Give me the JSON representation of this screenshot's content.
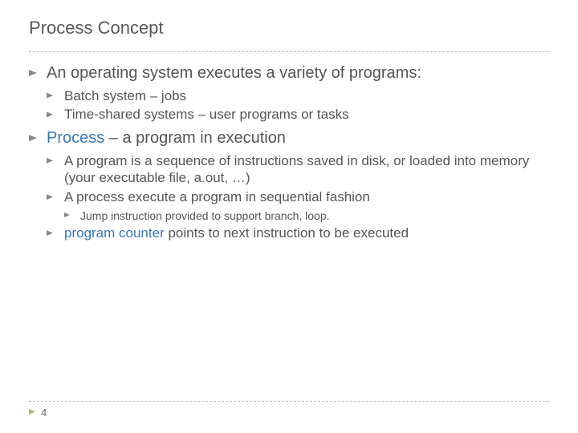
{
  "title": "Process Concept",
  "items": {
    "i0": "An operating system executes a variety of programs:",
    "i0_sub0": "Batch system – jobs",
    "i0_sub1": "Time-shared systems – user programs or tasks",
    "i1_blue": "Process",
    "i1_rest": " – a program in execution",
    "i1_sub0": "A program is a sequence of instructions saved in disk, or loaded into memory (your executable file, a.out, …)",
    "i1_sub1": "A process execute a program in sequential fashion",
    "i1_sub1_sub0": "Jump instruction provided to support branch, loop.",
    "i1_sub2_blue": "program counter",
    "i1_sub2_rest": " points to next instruction to be executed"
  },
  "page_number": "4"
}
